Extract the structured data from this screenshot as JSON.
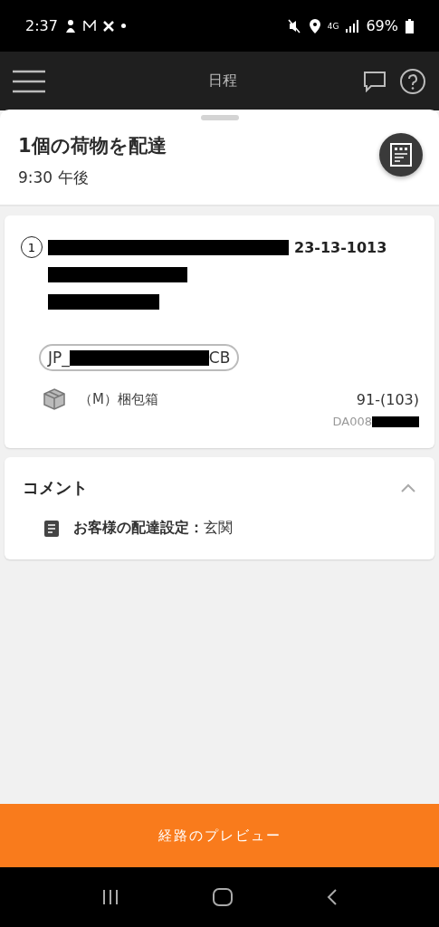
{
  "status_bar": {
    "time": "2:37",
    "network": "4G",
    "battery": "69%"
  },
  "header": {
    "title": "日程"
  },
  "summary": {
    "title": "1個の荷物を配達",
    "time": "9:30 午後"
  },
  "stop": {
    "number": "1",
    "address_visible": "23-13-1013",
    "tag_start": "JP_",
    "tag_end": "CB",
    "package": "（M）梱包箱",
    "count": "91-(103)",
    "id_visible": "DA008"
  },
  "comments": {
    "title": "コメント",
    "expanded": true,
    "note": "**お客様の配達設定：**玄関"
  },
  "action": {
    "label": "経路のプレビュー"
  }
}
